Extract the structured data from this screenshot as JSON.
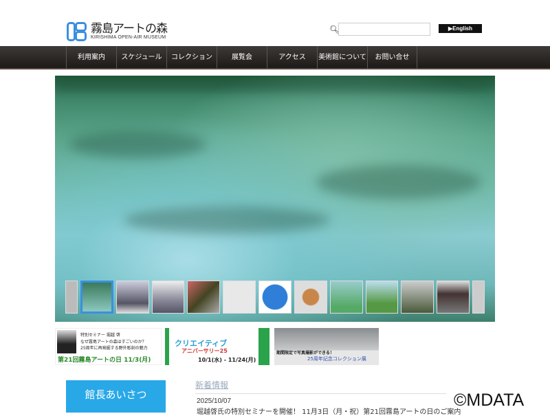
{
  "header": {
    "logo_title": "霧島アートの森",
    "logo_subtitle": "KIRISHIMA OPEN-AIR MUSEUM",
    "search_placeholder": "",
    "english_label": "▶English"
  },
  "nav": [
    "利用案内",
    "スケジュール",
    "コレクション",
    "展覧会",
    "アクセス",
    "美術館について",
    "お問い合せ"
  ],
  "banners": {
    "b1": {
      "line1": "特別セミナー 堀越 啓",
      "line2": "なぜ霧島アートの森はすごいのか？",
      "line3": "25周年に再発掘する野外彫刻の魅力",
      "line4": "第21回霧島アートの日 11/3(月)"
    },
    "b2": {
      "line1": "クリエイティブ",
      "line2": "アニバーサリー25",
      "line3": "10/1(水) - 11/24(月)"
    },
    "b3": {
      "line1": "期間限定で写真撮影ができる！",
      "line2": "25周年記念コレクション展"
    }
  },
  "sidebar": {
    "greeting": "館長あいさつ"
  },
  "news": {
    "title": "新着情報",
    "date": "2025/10/07",
    "text": "堀越啓氏の特別セミナーを開催！ 11月3日（月・祝）第21回霧島アートの日のご案内"
  },
  "watermark": "©MDATA",
  "colors": {
    "accent": "#3b8fe0",
    "nav": "#2a2523",
    "greeting": "#29a8e8"
  }
}
